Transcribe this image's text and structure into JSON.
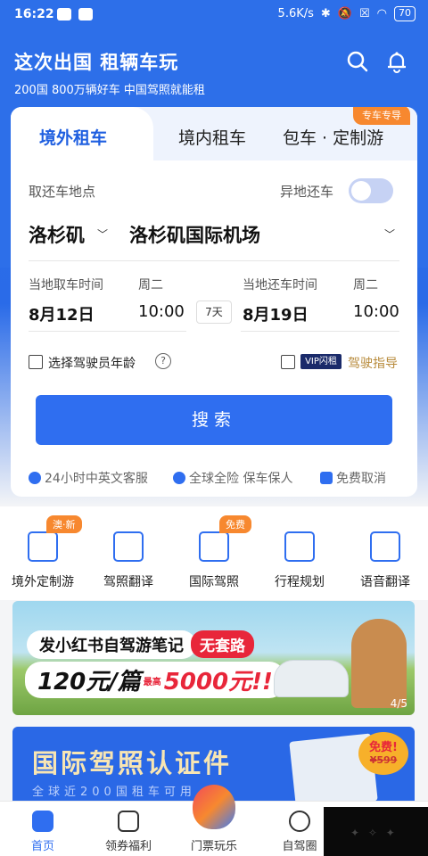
{
  "status": {
    "time": "16:22",
    "speed": "5.6K/s",
    "battery": "70"
  },
  "header": {
    "title": "这次出国 租辆车玩",
    "subtitle": "200国 800万辆好车 中国驾照就能租"
  },
  "tabs": [
    {
      "label": "境外租车"
    },
    {
      "label": "境内租车"
    },
    {
      "label": "包车 · 定制游"
    }
  ],
  "tab_badge": "专车专导",
  "form": {
    "pickup_label": "取还车地点",
    "diff_return_label": "异地还车",
    "diff_return_on": false,
    "city": "洛杉矶",
    "airport": "洛杉矶国际机场",
    "pickup_time_label": "当地取车时间",
    "pickup_weekday": "周二",
    "pickup_date": "8月12日",
    "pickup_time": "10:00",
    "days": "7天",
    "return_time_label": "当地还车时间",
    "return_weekday": "周二",
    "return_date": "8月19日",
    "return_time": "10:00",
    "driver_age_label": "选择驾驶员年龄",
    "vip_label": "VIP闪租",
    "driving_guide": "驾驶指导",
    "search_button": "搜索"
  },
  "features": [
    "24小时中英文客服",
    "全球全险 保车保人",
    "免费取消"
  ],
  "quick_menu": [
    {
      "label": "境外定制游",
      "badge": "澳·新"
    },
    {
      "label": "驾照翻译",
      "badge": ""
    },
    {
      "label": "国际驾照",
      "badge": "免费"
    },
    {
      "label": "行程规划",
      "badge": ""
    },
    {
      "label": "语音翻译",
      "badge": ""
    }
  ],
  "banner1": {
    "title": "发小红书自驾游笔记",
    "tag": "无套路",
    "price_a": "120元/篇",
    "price_small": "最高",
    "price_b": "5000元!!",
    "pager": "4/5"
  },
  "banner2": {
    "title": "国际驾照认证件",
    "subtitle": "全球近200国租车可用",
    "badge": "免费!",
    "old_price": "¥599"
  },
  "tabbar": [
    {
      "label": "首页"
    },
    {
      "label": "领券福利"
    },
    {
      "label": "门票玩乐"
    },
    {
      "label": "自驾圈"
    }
  ],
  "colors": {
    "brand": "#2f6ef0",
    "accent_orange": "#f7882f",
    "red": "#e8263a"
  }
}
